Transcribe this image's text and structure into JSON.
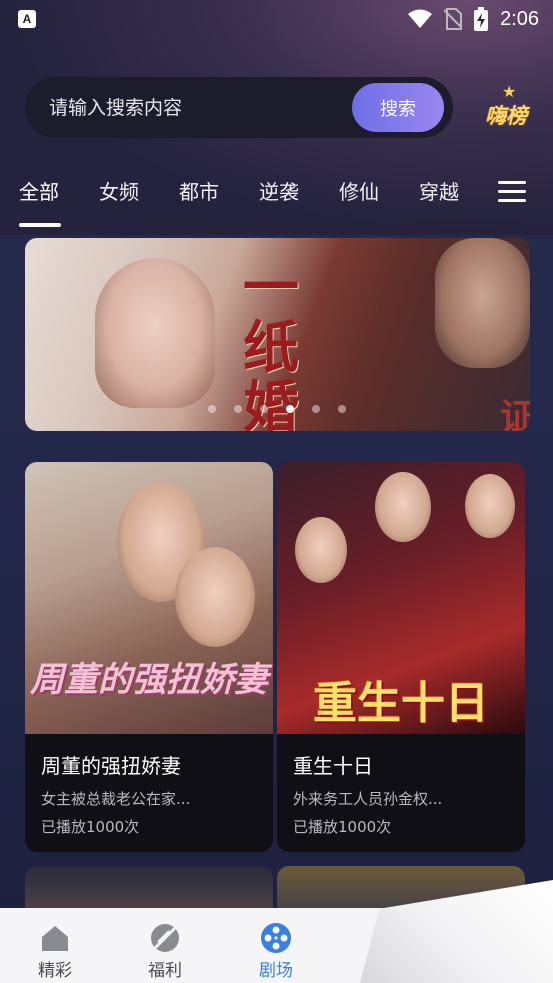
{
  "status_bar": {
    "app_icon_letter": "A",
    "time": "2:06"
  },
  "search": {
    "placeholder": "请输入搜索内容",
    "button_label": "搜索"
  },
  "rank": {
    "label": "嗨榜"
  },
  "tabs": [
    {
      "label": "全部",
      "active": true
    },
    {
      "label": "女频",
      "active": false
    },
    {
      "label": "都市",
      "active": false
    },
    {
      "label": "逆袭",
      "active": false
    },
    {
      "label": "修仙",
      "active": false
    },
    {
      "label": "穿越",
      "active": false
    }
  ],
  "banner": {
    "title_text": "一纸婚约",
    "stamp_text": "证",
    "dot_count": 6,
    "active_dot": 3
  },
  "cards": [
    {
      "poster_text": "周董的强扭娇妻",
      "title": "周董的强扭娇妻",
      "desc": "女主被总裁老公在家...",
      "plays": "已播放1000次"
    },
    {
      "poster_text": "重生十日",
      "title": "重生十日",
      "desc": "外来务工人员孙金权...",
      "plays": "已播放1000次"
    }
  ],
  "bottom_nav": [
    {
      "label": "精彩",
      "icon": "home-icon",
      "active": false
    },
    {
      "label": "福利",
      "icon": "welfare-icon",
      "active": false
    },
    {
      "label": "剧场",
      "icon": "film-reel-icon",
      "active": true
    }
  ],
  "colors": {
    "accent": "#3b7fe0",
    "nav_inactive": "#4a4a52",
    "search_button_start": "#6e6ee6",
    "search_button_end": "#9a86f0"
  }
}
